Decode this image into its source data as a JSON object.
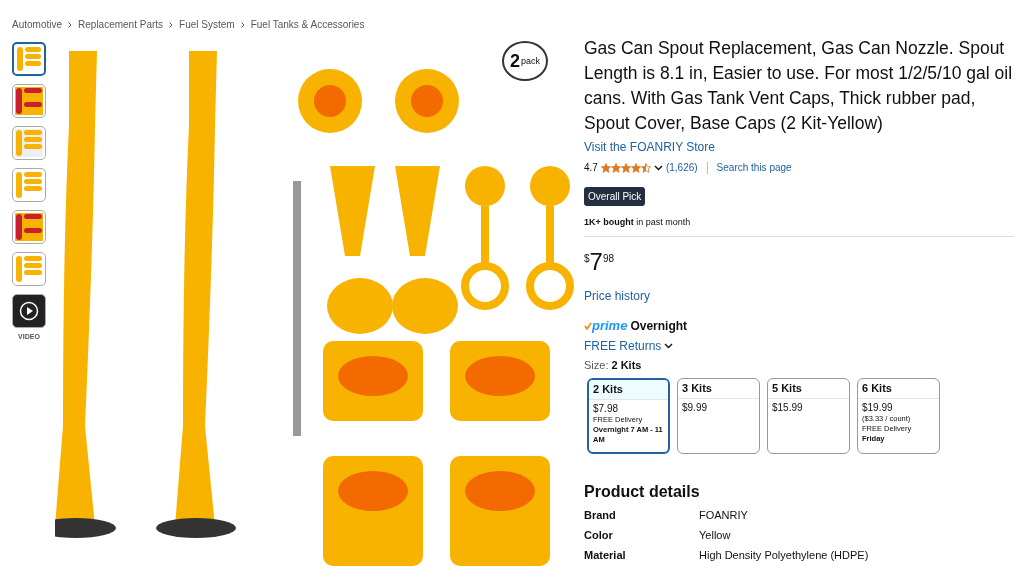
{
  "breadcrumb": [
    "Automotive",
    "Replacement Parts",
    "Fuel System",
    "Fuel Tanks & Accessories"
  ],
  "thumbnails": [
    {
      "selected": true
    },
    {
      "selected": false
    },
    {
      "selected": false
    },
    {
      "selected": false
    },
    {
      "selected": false
    },
    {
      "selected": false
    }
  ],
  "video_thumbnail": {
    "label": "VIDEO"
  },
  "image_badge": {
    "count": "2",
    "unit": "pack"
  },
  "product": {
    "title": "Gas Can Spout Replacement, Gas Can Nozzle. Spout Length is 8.1 in, Easier to use. For most 1/2/5/10 gal oil cans. With Gas Tank Vent Caps, Thick rubber pad, Spout Cover, Base Caps (2 Kit-Yellow)",
    "store_link": "Visit the FOANRIY Store",
    "rating": "4.7",
    "stars": 4.5,
    "review_count": "(1,626)",
    "search_link": "Search this page",
    "badge": "Overall Pick",
    "bought": "**1K+ bought** in past month",
    "price_symbol": "$",
    "price_whole": "7",
    "price_fraction": "98",
    "price_history": "Price history",
    "prime": "prime",
    "delivery_speed": "Overnight",
    "returns": "FREE Returns",
    "size_label": "Size:",
    "size_value": "2 Kits"
  },
  "size_options": [
    {
      "title": "2 Kits",
      "price": "$7.98",
      "delivery": "FREE Delivery",
      "delivery_time": "Overnight 7 AM - 11 AM",
      "selected": true
    },
    {
      "title": "3 Kits",
      "price": "$9.99",
      "selected": false
    },
    {
      "title": "5 Kits",
      "price": "$15.99",
      "selected": false
    },
    {
      "title": "6 Kits",
      "price": "$19.99",
      "unit_price": "($3.33 / count)",
      "delivery": "FREE Delivery",
      "delivery_time": "Friday",
      "selected": false
    }
  ],
  "product_details": {
    "heading": "Product details",
    "rows": [
      {
        "label": "Brand",
        "value": "FOANRIY"
      },
      {
        "label": "Color",
        "value": "Yellow"
      },
      {
        "label": "Material",
        "value": "High Density Polyethylene (HDPE)"
      }
    ]
  }
}
